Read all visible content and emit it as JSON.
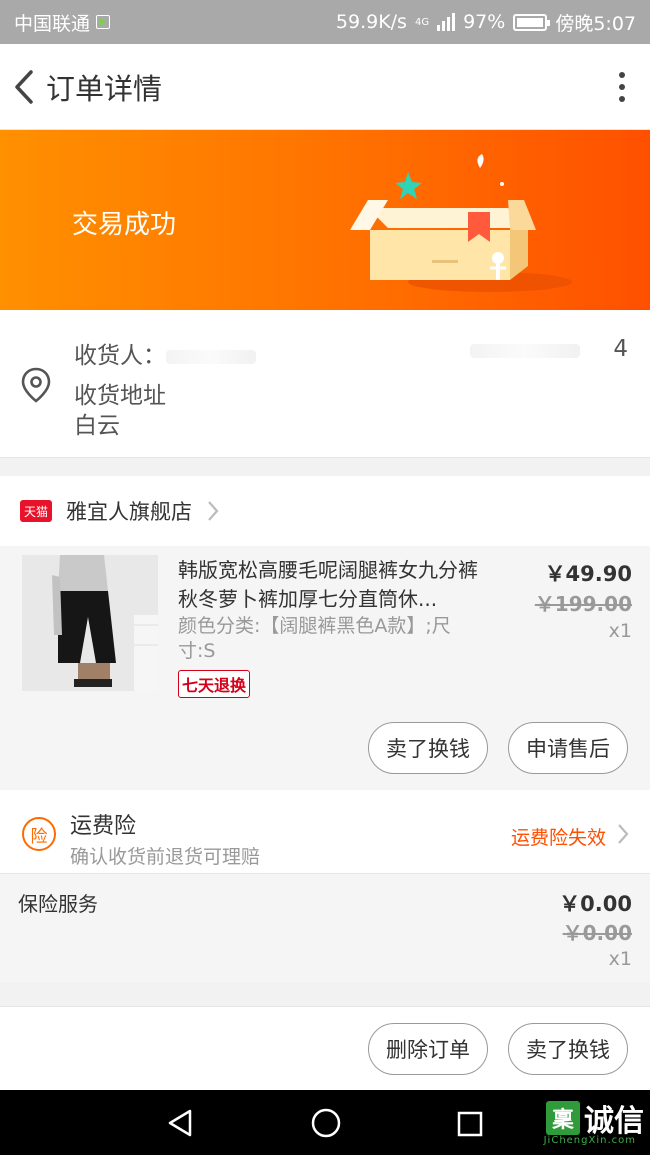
{
  "status_bar": {
    "carrier": "中国联通",
    "speed": "59.9K/s",
    "network": "4G",
    "battery": "97%",
    "time": "傍晚5:07"
  },
  "nav": {
    "title": "订单详情"
  },
  "banner": {
    "status": "交易成功"
  },
  "address": {
    "recipient_label": "收货人：",
    "recipient_name_visible": "",
    "phone_visible": "4",
    "address_label": "收货地址",
    "address_city": "白云"
  },
  "shop": {
    "badge": "天猫",
    "name": "雅宜人旗舰店"
  },
  "item": {
    "title": "韩版宽松高腰毛呢阔腿裤女九分裤秋冬萝卜裤加厚七分直筒休...",
    "sku": "颜色分类:【阔腿裤黑色A款】;尺寸:S",
    "tag": "七天退换",
    "price": "￥49.90",
    "original_price": "￥199.00",
    "quantity": "x1",
    "button_resell": "卖了换钱",
    "button_aftersale": "申请售后"
  },
  "freight": {
    "icon_char": "险",
    "title": "运费险",
    "subtitle": "确认收货前退货可理赔",
    "status": "运费险失效"
  },
  "insurance": {
    "label": "保险服务",
    "price": "￥0.00",
    "original_price": "￥0.00",
    "quantity": "x1"
  },
  "footer": {
    "button_delete": "删除订单",
    "button_resell": "卖了换钱"
  },
  "watermark": {
    "icon_char": "稟",
    "text": "诚信",
    "sub": "JiChengXin.com"
  },
  "colors": {
    "accent": "#ff5000",
    "banner_start": "#ff9000",
    "banner_end": "#ff5000",
    "tmall_red": "#e8132b",
    "tag_red": "#d4001a"
  }
}
